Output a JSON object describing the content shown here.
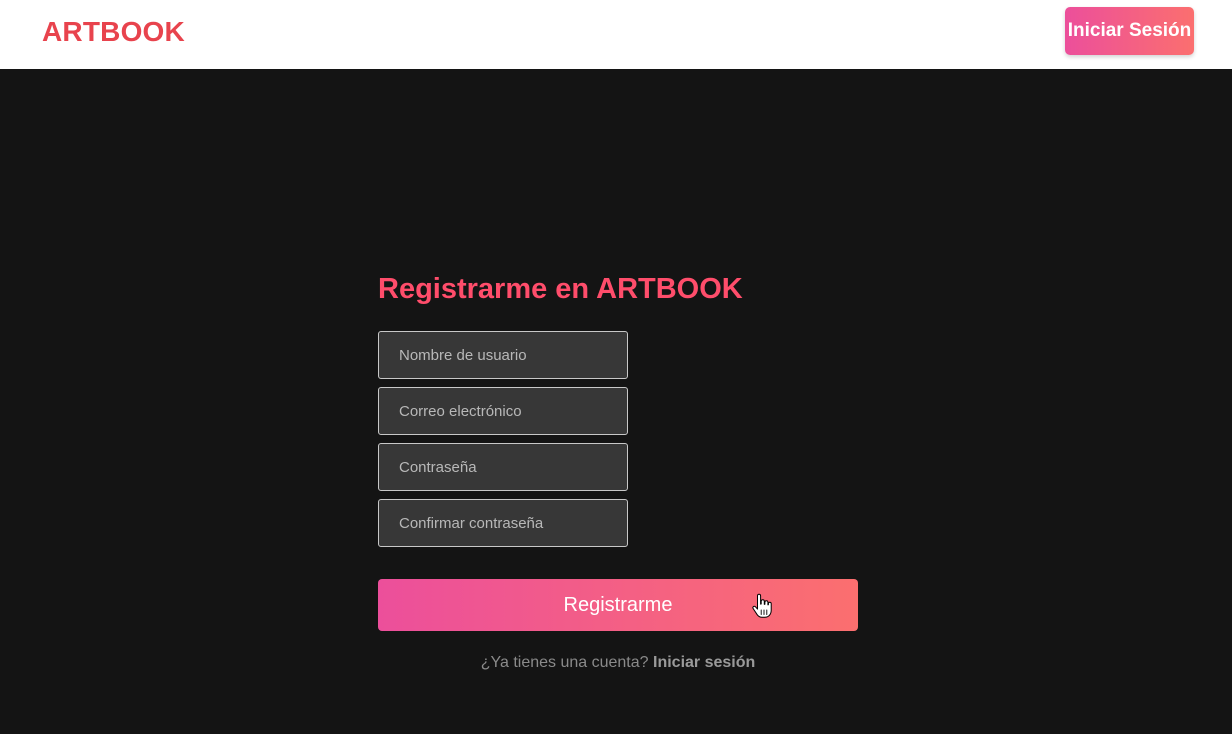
{
  "header": {
    "brand": "ARTBOOK",
    "login_button": "Iniciar Sesión"
  },
  "form": {
    "title": "Registrarme en ARTBOOK",
    "fields": [
      {
        "placeholder": "Nombre de usuario",
        "value": ""
      },
      {
        "placeholder": "Correo electrónico",
        "value": ""
      },
      {
        "placeholder": "Contraseña",
        "value": ""
      },
      {
        "placeholder": "Confirmar contraseña",
        "value": ""
      }
    ],
    "submit_label": "Registrarme",
    "footer_prompt": "¿Ya tienes una cuenta?",
    "footer_link": "Iniciar sesión"
  },
  "colors": {
    "brand": "#e8434d",
    "title": "#ff4d6b",
    "gradient_start": "#ec4f9b",
    "gradient_end": "#fb6f6f",
    "background": "#141414",
    "field_bg": "#373737"
  }
}
